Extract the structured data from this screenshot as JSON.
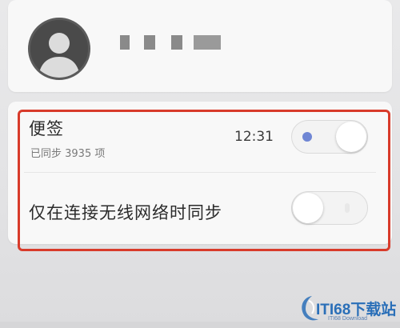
{
  "account": {
    "avatar_icon": "default-user-avatar-icon",
    "name_masked": true
  },
  "sync": {
    "notes": {
      "title": "便签",
      "subtitle": "已同步 3935 项",
      "time": "12:31",
      "enabled": true
    },
    "wifi_only": {
      "title": "仅在连接无线网络时同步",
      "enabled": false
    }
  },
  "colors": {
    "highlight": "#d83b2b",
    "toggle_dot": "#6f86d4",
    "watermark": "#2a6fb8"
  },
  "watermark": {
    "text": "ITI68下载站",
    "sub": "ITI68 Download"
  }
}
